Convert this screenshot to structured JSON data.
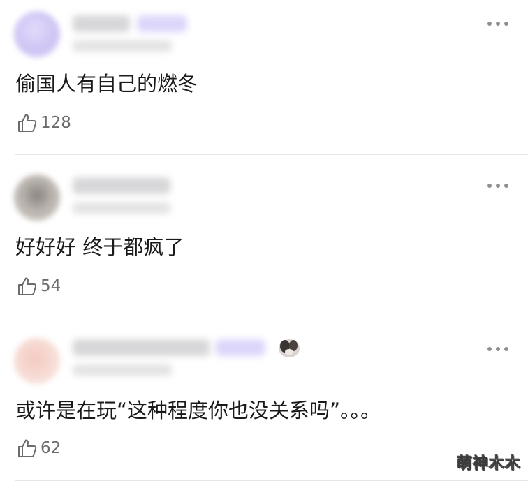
{
  "comments": [
    {
      "text": "偷国人有自己的燃冬",
      "likes": "128",
      "avatar_color": "#cec4f4",
      "has_tag": true
    },
    {
      "text": "好好好 终于都疯了",
      "likes": "54",
      "avatar_color": "#b9b3ad",
      "has_tag": false
    },
    {
      "text": "或许是在玩“这种程度你也没关系吗”。。。",
      "likes": "62",
      "avatar_color": "#f7ddd6",
      "has_tag": true,
      "has_sticker": true
    }
  ],
  "icons": {
    "like": "thumbs-up-icon",
    "more": "more-horizontal-icon"
  },
  "watermark": "萌神木木",
  "colors": {
    "text": "#1a1a1a",
    "count": "#6b6b6b",
    "divider": "#e6e6e6",
    "tag": "#dcd6fa"
  }
}
